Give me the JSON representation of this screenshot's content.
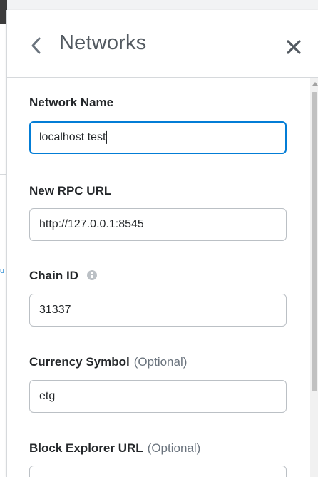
{
  "header": {
    "title": "Networks"
  },
  "form": {
    "network_name": {
      "label": "Network Name",
      "value": "localhost test"
    },
    "rpc_url": {
      "label": "New RPC URL",
      "value": "http://127.0.0.1:8545"
    },
    "chain_id": {
      "label": "Chain ID",
      "value": "31337"
    },
    "currency_symbol": {
      "label": "Currency Symbol",
      "optional": "(Optional)",
      "value": "etg"
    },
    "block_explorer": {
      "label": "Block Explorer URL",
      "optional": "(Optional)",
      "value": ""
    }
  },
  "background": {
    "glyph": "u"
  },
  "colors": {
    "accent": "#037dd6",
    "border": "#bbc0c5",
    "text": "#24272a",
    "muted": "#6a737d"
  }
}
